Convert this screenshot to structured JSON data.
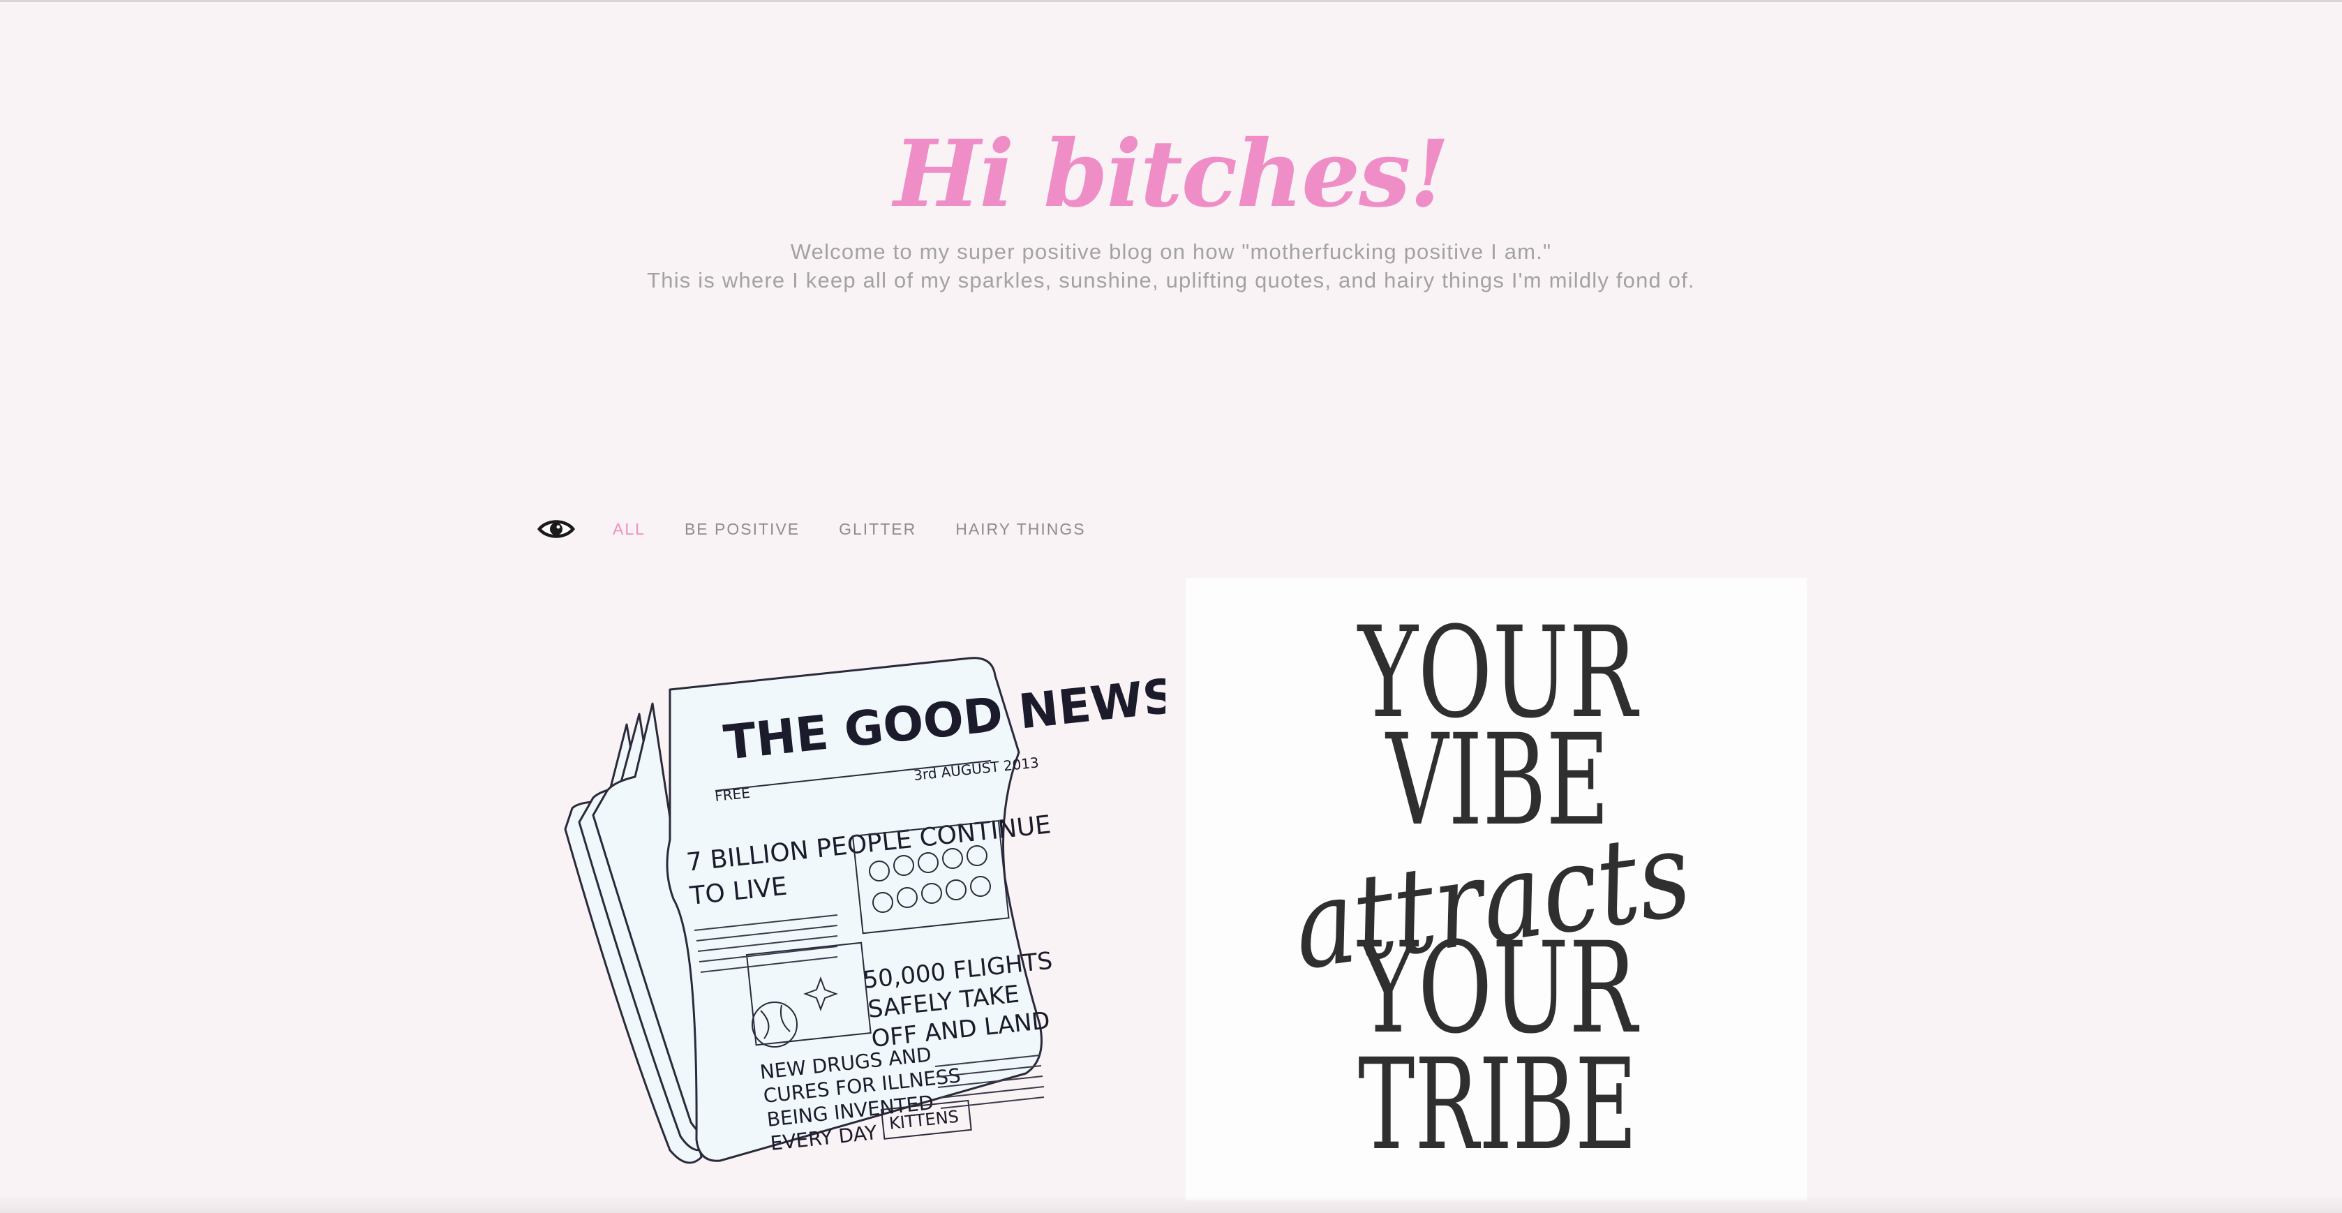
{
  "header": {
    "title": "Hi bitches!",
    "tagline_line1": "Welcome to my super positive blog on how \"motherfucking positive I am.\"",
    "tagline_line2": "This is where I keep all of my sparkles, sunshine, uplifting quotes, and hairy things I'm mildly fond of."
  },
  "filters": {
    "icon": "eye-icon",
    "items": [
      {
        "label": "ALL",
        "active": true
      },
      {
        "label": "BE POSITIVE",
        "active": false
      },
      {
        "label": "GLITTER",
        "active": false
      },
      {
        "label": "HAIRY THINGS",
        "active": false
      }
    ]
  },
  "posts": {
    "news": {
      "masthead": "THE GOOD NEWS",
      "price": "FREE",
      "date": "3rd AUGUST 2013",
      "headline1_a": "7 BILLION PEOPLE CONTINUE",
      "headline1_b": "TO LIVE",
      "headline2_a": "50,000 FLIGHTS",
      "headline2_b": "SAFELY TAKE",
      "headline2_c": "OFF AND LAND",
      "headline3_a": "NEW DRUGS AND",
      "headline3_b": "CURES FOR ILLNESS",
      "headline3_c": "BEING INVENTED",
      "headline3_d": "EVERY DAY",
      "box_label": "KITTENS"
    },
    "quote": {
      "line1": "YOUR",
      "line2": "VIBE",
      "line3": "attracts",
      "line4": "YOUR",
      "line5": "TRIBE"
    }
  },
  "colors": {
    "background": "#faf3f6",
    "accent": "#ef8ec6",
    "muted_text": "#a2a2a2",
    "nav_text": "#8d8d8d"
  }
}
